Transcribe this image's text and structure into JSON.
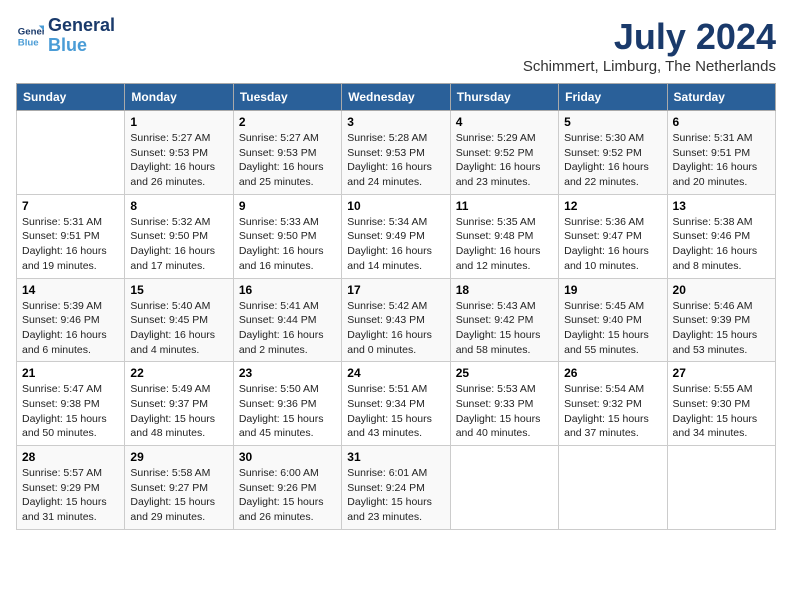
{
  "header": {
    "logo_line1": "General",
    "logo_line2": "Blue",
    "month_title": "July 2024",
    "location": "Schimmert, Limburg, The Netherlands"
  },
  "days_of_week": [
    "Sunday",
    "Monday",
    "Tuesday",
    "Wednesday",
    "Thursday",
    "Friday",
    "Saturday"
  ],
  "weeks": [
    [
      {
        "num": "",
        "info": ""
      },
      {
        "num": "1",
        "info": "Sunrise: 5:27 AM\nSunset: 9:53 PM\nDaylight: 16 hours\nand 26 minutes."
      },
      {
        "num": "2",
        "info": "Sunrise: 5:27 AM\nSunset: 9:53 PM\nDaylight: 16 hours\nand 25 minutes."
      },
      {
        "num": "3",
        "info": "Sunrise: 5:28 AM\nSunset: 9:53 PM\nDaylight: 16 hours\nand 24 minutes."
      },
      {
        "num": "4",
        "info": "Sunrise: 5:29 AM\nSunset: 9:52 PM\nDaylight: 16 hours\nand 23 minutes."
      },
      {
        "num": "5",
        "info": "Sunrise: 5:30 AM\nSunset: 9:52 PM\nDaylight: 16 hours\nand 22 minutes."
      },
      {
        "num": "6",
        "info": "Sunrise: 5:31 AM\nSunset: 9:51 PM\nDaylight: 16 hours\nand 20 minutes."
      }
    ],
    [
      {
        "num": "7",
        "info": "Sunrise: 5:31 AM\nSunset: 9:51 PM\nDaylight: 16 hours\nand 19 minutes."
      },
      {
        "num": "8",
        "info": "Sunrise: 5:32 AM\nSunset: 9:50 PM\nDaylight: 16 hours\nand 17 minutes."
      },
      {
        "num": "9",
        "info": "Sunrise: 5:33 AM\nSunset: 9:50 PM\nDaylight: 16 hours\nand 16 minutes."
      },
      {
        "num": "10",
        "info": "Sunrise: 5:34 AM\nSunset: 9:49 PM\nDaylight: 16 hours\nand 14 minutes."
      },
      {
        "num": "11",
        "info": "Sunrise: 5:35 AM\nSunset: 9:48 PM\nDaylight: 16 hours\nand 12 minutes."
      },
      {
        "num": "12",
        "info": "Sunrise: 5:36 AM\nSunset: 9:47 PM\nDaylight: 16 hours\nand 10 minutes."
      },
      {
        "num": "13",
        "info": "Sunrise: 5:38 AM\nSunset: 9:46 PM\nDaylight: 16 hours\nand 8 minutes."
      }
    ],
    [
      {
        "num": "14",
        "info": "Sunrise: 5:39 AM\nSunset: 9:46 PM\nDaylight: 16 hours\nand 6 minutes."
      },
      {
        "num": "15",
        "info": "Sunrise: 5:40 AM\nSunset: 9:45 PM\nDaylight: 16 hours\nand 4 minutes."
      },
      {
        "num": "16",
        "info": "Sunrise: 5:41 AM\nSunset: 9:44 PM\nDaylight: 16 hours\nand 2 minutes."
      },
      {
        "num": "17",
        "info": "Sunrise: 5:42 AM\nSunset: 9:43 PM\nDaylight: 16 hours\nand 0 minutes."
      },
      {
        "num": "18",
        "info": "Sunrise: 5:43 AM\nSunset: 9:42 PM\nDaylight: 15 hours\nand 58 minutes."
      },
      {
        "num": "19",
        "info": "Sunrise: 5:45 AM\nSunset: 9:40 PM\nDaylight: 15 hours\nand 55 minutes."
      },
      {
        "num": "20",
        "info": "Sunrise: 5:46 AM\nSunset: 9:39 PM\nDaylight: 15 hours\nand 53 minutes."
      }
    ],
    [
      {
        "num": "21",
        "info": "Sunrise: 5:47 AM\nSunset: 9:38 PM\nDaylight: 15 hours\nand 50 minutes."
      },
      {
        "num": "22",
        "info": "Sunrise: 5:49 AM\nSunset: 9:37 PM\nDaylight: 15 hours\nand 48 minutes."
      },
      {
        "num": "23",
        "info": "Sunrise: 5:50 AM\nSunset: 9:36 PM\nDaylight: 15 hours\nand 45 minutes."
      },
      {
        "num": "24",
        "info": "Sunrise: 5:51 AM\nSunset: 9:34 PM\nDaylight: 15 hours\nand 43 minutes."
      },
      {
        "num": "25",
        "info": "Sunrise: 5:53 AM\nSunset: 9:33 PM\nDaylight: 15 hours\nand 40 minutes."
      },
      {
        "num": "26",
        "info": "Sunrise: 5:54 AM\nSunset: 9:32 PM\nDaylight: 15 hours\nand 37 minutes."
      },
      {
        "num": "27",
        "info": "Sunrise: 5:55 AM\nSunset: 9:30 PM\nDaylight: 15 hours\nand 34 minutes."
      }
    ],
    [
      {
        "num": "28",
        "info": "Sunrise: 5:57 AM\nSunset: 9:29 PM\nDaylight: 15 hours\nand 31 minutes."
      },
      {
        "num": "29",
        "info": "Sunrise: 5:58 AM\nSunset: 9:27 PM\nDaylight: 15 hours\nand 29 minutes."
      },
      {
        "num": "30",
        "info": "Sunrise: 6:00 AM\nSunset: 9:26 PM\nDaylight: 15 hours\nand 26 minutes."
      },
      {
        "num": "31",
        "info": "Sunrise: 6:01 AM\nSunset: 9:24 PM\nDaylight: 15 hours\nand 23 minutes."
      },
      {
        "num": "",
        "info": ""
      },
      {
        "num": "",
        "info": ""
      },
      {
        "num": "",
        "info": ""
      }
    ]
  ]
}
